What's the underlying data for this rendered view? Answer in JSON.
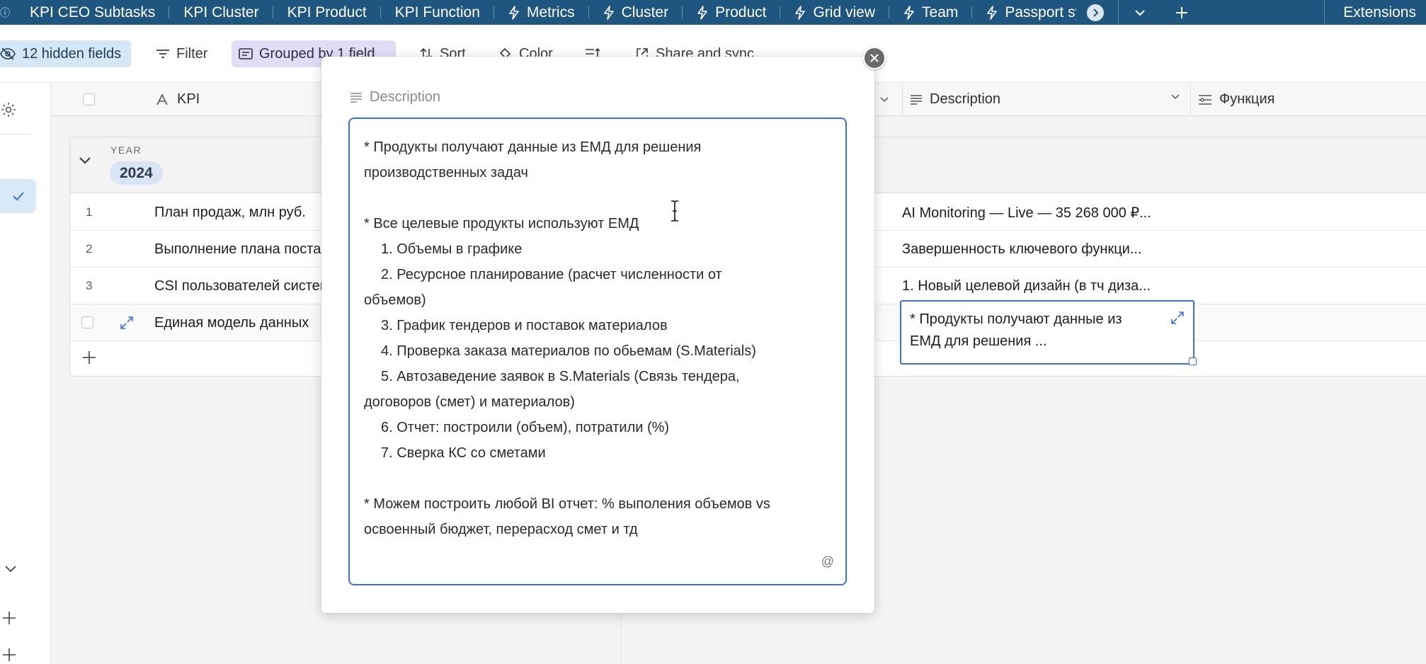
{
  "tabs": [
    {
      "label": "KPI CEO Subtasks",
      "bolt": false
    },
    {
      "label": "KPI Cluster",
      "bolt": false
    },
    {
      "label": "KPI Product",
      "bolt": false
    },
    {
      "label": "KPI Function",
      "bolt": false
    },
    {
      "label": "Metrics",
      "bolt": true
    },
    {
      "label": "Cluster",
      "bolt": true
    },
    {
      "label": "Product",
      "bolt": true
    },
    {
      "label": "Grid view",
      "bolt": true
    },
    {
      "label": "Team",
      "bolt": true
    },
    {
      "label": "Passport sy",
      "bolt": true
    }
  ],
  "tabbar_right": {
    "extensions": "Extensions"
  },
  "toolbar": {
    "hidden_fields": "12 hidden fields",
    "filter": "Filter",
    "grouped": "Grouped by 1 field",
    "sort": "Sort",
    "color": "Color",
    "share": "Share and sync"
  },
  "columns": {
    "kpi": "KPI",
    "description": "Description",
    "function": "Функция"
  },
  "group": {
    "field_label": "YEAR",
    "value": "2024"
  },
  "rows": [
    {
      "num": "1",
      "kpi": "План продаж, млн руб.",
      "description": "AI Monitoring — Live — 35 268 000 ₽..."
    },
    {
      "num": "2",
      "kpi": "Выполнение плана поставок",
      "description": "Завершенность ключевого функци..."
    },
    {
      "num": "3",
      "kpi": "CSI пользователей системы",
      "description": "1. Новый целевой дизайн (в тч диза..."
    },
    {
      "num": "",
      "kpi": "Единая модель данных",
      "description": ""
    }
  ],
  "active_cell": {
    "line1": "* Продукты получают данные из",
    "line2": "ЕМД для решения ..."
  },
  "popup": {
    "label": "Description",
    "lines": [
      "* Продукты получают данные из ЕМД для решения",
      "производственных задач",
      "",
      "* Все целевые продукты используют ЕМД",
      "1. Объемы в графике",
      "2. Ресурсное планирование (расчет численности от",
      "объемов)",
      "3. График тендеров и поставок материалов",
      "4. Проверка заказа материалов по обьемам (S.Materials)",
      "5. Автозаведение заявок в S.Materials (Связь тендера,",
      "договоров (смет) и материалов)",
      "6. Отчет: построили (объем), потратили (%)",
      "7. Сверка КС со сметами",
      "",
      "* Можем построить любой BI отчет: % выполения объемов vs",
      "освоенный бюджет, перерасход смет и тд"
    ],
    "mention_symbol": "@"
  },
  "colors": {
    "tabbar_bg": "#1e5680",
    "accent_blue": "#3e6fd6",
    "hidden_fields_bg": "#d4e7f6",
    "grouped_bg": "#e3dcf6",
    "year_chip_bg": "#d9e4f5"
  }
}
